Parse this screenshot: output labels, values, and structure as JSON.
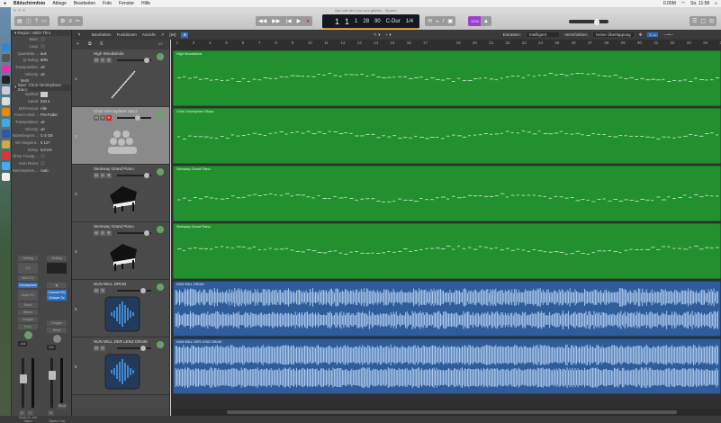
{
  "menubar": {
    "items": [
      "Bildschirmfoto",
      "Ablage",
      "Bearbeiten",
      "Foto",
      "Fenster",
      "Hilfe"
    ],
    "status": [
      "0.00M",
      "So. 11:58"
    ]
  },
  "window": {
    "title": "Nun will der Lenz uns grüßen - Spuren"
  },
  "lcd": {
    "bar": "1",
    "beat": "1",
    "div": "1",
    "tempo_a": "28",
    "tempo": "90",
    "key": "C-Dur",
    "sig": "1/4"
  },
  "toolbar": {
    "count_in": "1234"
  },
  "editbar": {
    "menus": [
      "Bearbeiten",
      "Funktionen",
      "Ansicht"
    ],
    "snap_label": "Einrasten:",
    "snap_value": "Intelligent",
    "drag_label": "Verschieben:",
    "drag_value": "Keine Überlappung"
  },
  "ruler": [
    "2",
    "3",
    "4",
    "5",
    "6",
    "7",
    "8",
    "9",
    "10",
    "11",
    "12",
    "13",
    "14",
    "15",
    "16",
    "17",
    "19",
    "20",
    "21",
    "22",
    "23",
    "24",
    "25",
    "26",
    "27",
    "28",
    "29",
    "30",
    "31",
    "32",
    "33",
    "34",
    "35"
  ],
  "inspector": {
    "region_header": "Region: MIDI Thru",
    "region_rows": [
      [
        "Mute:",
        ""
      ],
      [
        "Loop:",
        ""
      ],
      [
        "Quantisier...:",
        "aus"
      ],
      [
        "Q-Swing:",
        "50%"
      ],
      [
        "Transposition:",
        "±0"
      ],
      [
        "Velocity:",
        "±0"
      ]
    ],
    "more": "Mehr",
    "track_header": "Spur: Choir Omnisphere Stacc",
    "track_rows": [
      [
        "Symbol:",
        ""
      ],
      [
        "Kanal:",
        "Inst 4"
      ],
      [
        "MIDI-Kanal:",
        "Alle"
      ],
      [
        "Freeze-Mod...:",
        "Pre-Fader"
      ],
      [
        "Transposition:",
        "±0"
      ],
      [
        "Velocity:",
        "±0"
      ],
      [
        "Notenbegren...:",
        "C-2   G8"
      ],
      [
        "Vel.-Begrenz.:",
        "0   127"
      ],
      [
        "Delay:",
        "0,0 ms"
      ],
      [
        "Ohne Transp...:",
        ""
      ],
      [
        "Kein Reset:",
        ""
      ],
      [
        "Notensystem...:",
        "Auto"
      ]
    ],
    "strip1": {
      "setting": "Setting",
      "eq": "EQ",
      "midifx": "MIDI FX",
      "instrument": "Omnisphere",
      "audiofx": "Audio FX",
      "send": "Send",
      "output": "Stereo",
      "group": "Gruppe",
      "automation": "Read",
      "value": "-4,6",
      "mute": "M",
      "solo": "S",
      "name": "Choir O...ere Stacc"
    },
    "strip2": {
      "setting": "Setting",
      "plugins": [
        "Channel EQ",
        "iZotope Oz"
      ],
      "group": "Gruppe",
      "automation": "Read",
      "value": "0,0",
      "mute": "M",
      "name": "Stereo Out",
      "bounce": "Bnce"
    }
  },
  "tracks": [
    {
      "num": "1",
      "name": "High Woodwinds",
      "type": "midi",
      "icon": "flute-icon",
      "region": "High Woodwinds",
      "record": false
    },
    {
      "num": "2",
      "name": "Choir Omnisphere Stacc",
      "type": "midi",
      "icon": "choir-icon",
      "region": "Choir Omnisphere Stacc",
      "record": true,
      "selected": true
    },
    {
      "num": "3",
      "name": "Steinway Grand Piano",
      "type": "midi",
      "icon": "piano-icon",
      "region": "Steinway Grand Piano",
      "record": false
    },
    {
      "num": "4",
      "name": "Steinway Grand Piano",
      "type": "midi",
      "icon": "piano-icon",
      "region": "Steinway Grand Piano",
      "record": false
    },
    {
      "num": "5",
      "name": "NUN WILL DRUM",
      "type": "audio",
      "icon": "waveform-icon",
      "region": "NUN WILL DRUM"
    },
    {
      "num": "6",
      "name": "NUN WILL DER LENZ DRUM",
      "type": "audio",
      "icon": "waveform-icon",
      "region": "NUN WILL DER LENZ DRUM"
    }
  ],
  "colors": {
    "midi_region": "#23902f",
    "audio_region": "#2f5c9a",
    "record": "#dd2222",
    "accent": "#2e6fc0",
    "count_in": "#9b3fd0"
  }
}
